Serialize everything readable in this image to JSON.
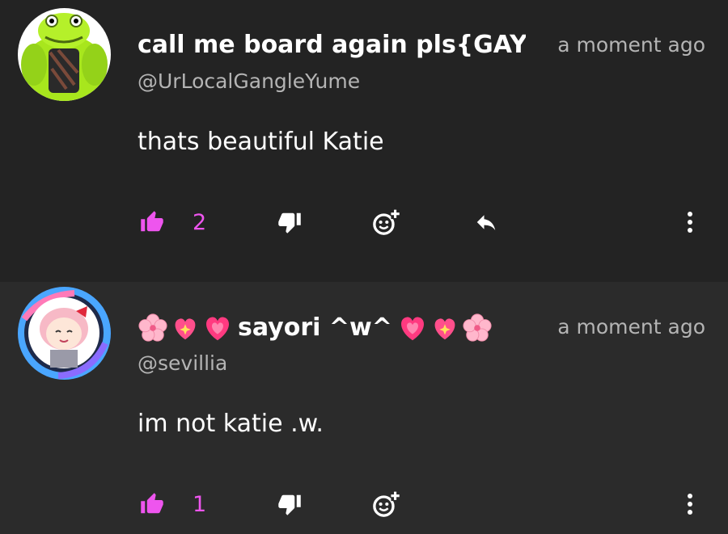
{
  "comments": [
    {
      "display_name": "call me board again pls{GAY}",
      "handle": "@UrLocalGangleYume",
      "timestamp": "a moment ago",
      "text": "thats beautiful Katie",
      "like_count": "2"
    },
    {
      "display_name": "sayori ^w^",
      "handle": "@sevillia",
      "timestamp": "a moment ago",
      "text": "im not katie .w.",
      "like_count": "1"
    }
  ],
  "colors": {
    "accent_pink": "#ee55ee",
    "background": "#232323",
    "muted_text": "#b4b4b4"
  },
  "icons": {
    "like": "thumbs-up-icon",
    "dislike": "thumbs-down-icon",
    "react": "add-reaction-icon",
    "reply": "reply-arrow-icon",
    "more": "more-vertical-icon",
    "name_decor": [
      "cherry-blossom-emoji",
      "sparkling-heart-emoji",
      "growing-heart-emoji"
    ]
  }
}
